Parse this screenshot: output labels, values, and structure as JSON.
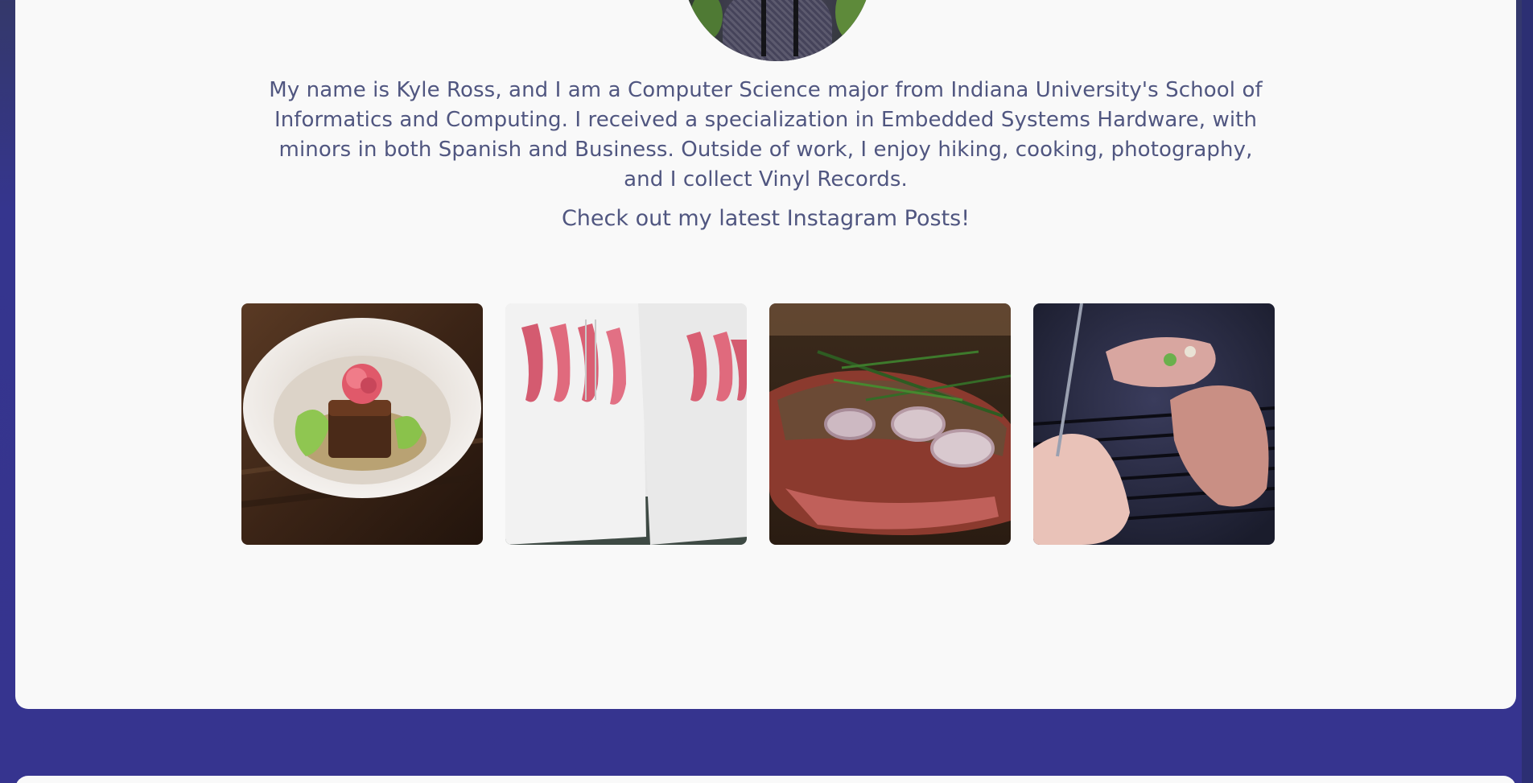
{
  "about": {
    "bio": "My name is Kyle Ross, and I am a Computer Science major from Indiana University's School of Informatics and Computing. I received a specialization in Embedded Systems Hardware, with minors in both Spanish and Business. Outside of work, I enjoy hiking, cooking, photography, and I collect Vinyl Records.",
    "instagram_heading": "Check out my latest Instagram Posts!"
  },
  "colors": {
    "page_background": "#36348f",
    "card_background": "#f9f9f9",
    "body_text": "#505680"
  },
  "instagram_posts": [
    {
      "name": "food-bowl-photo"
    },
    {
      "name": "hoodies-photo"
    },
    {
      "name": "steak-rosemary-photo"
    },
    {
      "name": "grilled-chicken-photo"
    }
  ]
}
